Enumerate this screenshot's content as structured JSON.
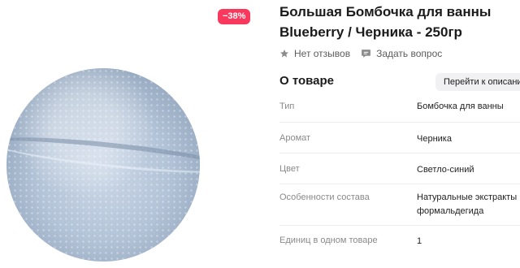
{
  "product": {
    "discount_badge": "−38%",
    "title_line1": "Большая Бомбочка для ванны",
    "title_line2": "Blueberry / Черника - 250гр",
    "image_icon": "bath-bomb-photo"
  },
  "meta": {
    "reviews_label": "Нет отзывов",
    "reviews_icon": "star-icon",
    "ask_label": "Задать вопрос",
    "ask_icon": "chat-bubble-icon"
  },
  "about": {
    "heading": "О товаре",
    "description_link": "Перейти к описанию"
  },
  "specs": [
    {
      "label": "Тип",
      "value": "Бомбочка для ванны"
    },
    {
      "label": "Аромат",
      "value": "Черника"
    },
    {
      "label": "Цвет",
      "value": "Светло-синий"
    },
    {
      "label": "Особенности состава",
      "value": "Натуральные экстракты",
      "value2": "формальдегида"
    },
    {
      "label": "Единиц в одном товаре",
      "value": "1"
    }
  ],
  "colors": {
    "badge": "#f8385c",
    "link_bg": "#f1f1f3",
    "label_gray": "#8a8a8a"
  }
}
